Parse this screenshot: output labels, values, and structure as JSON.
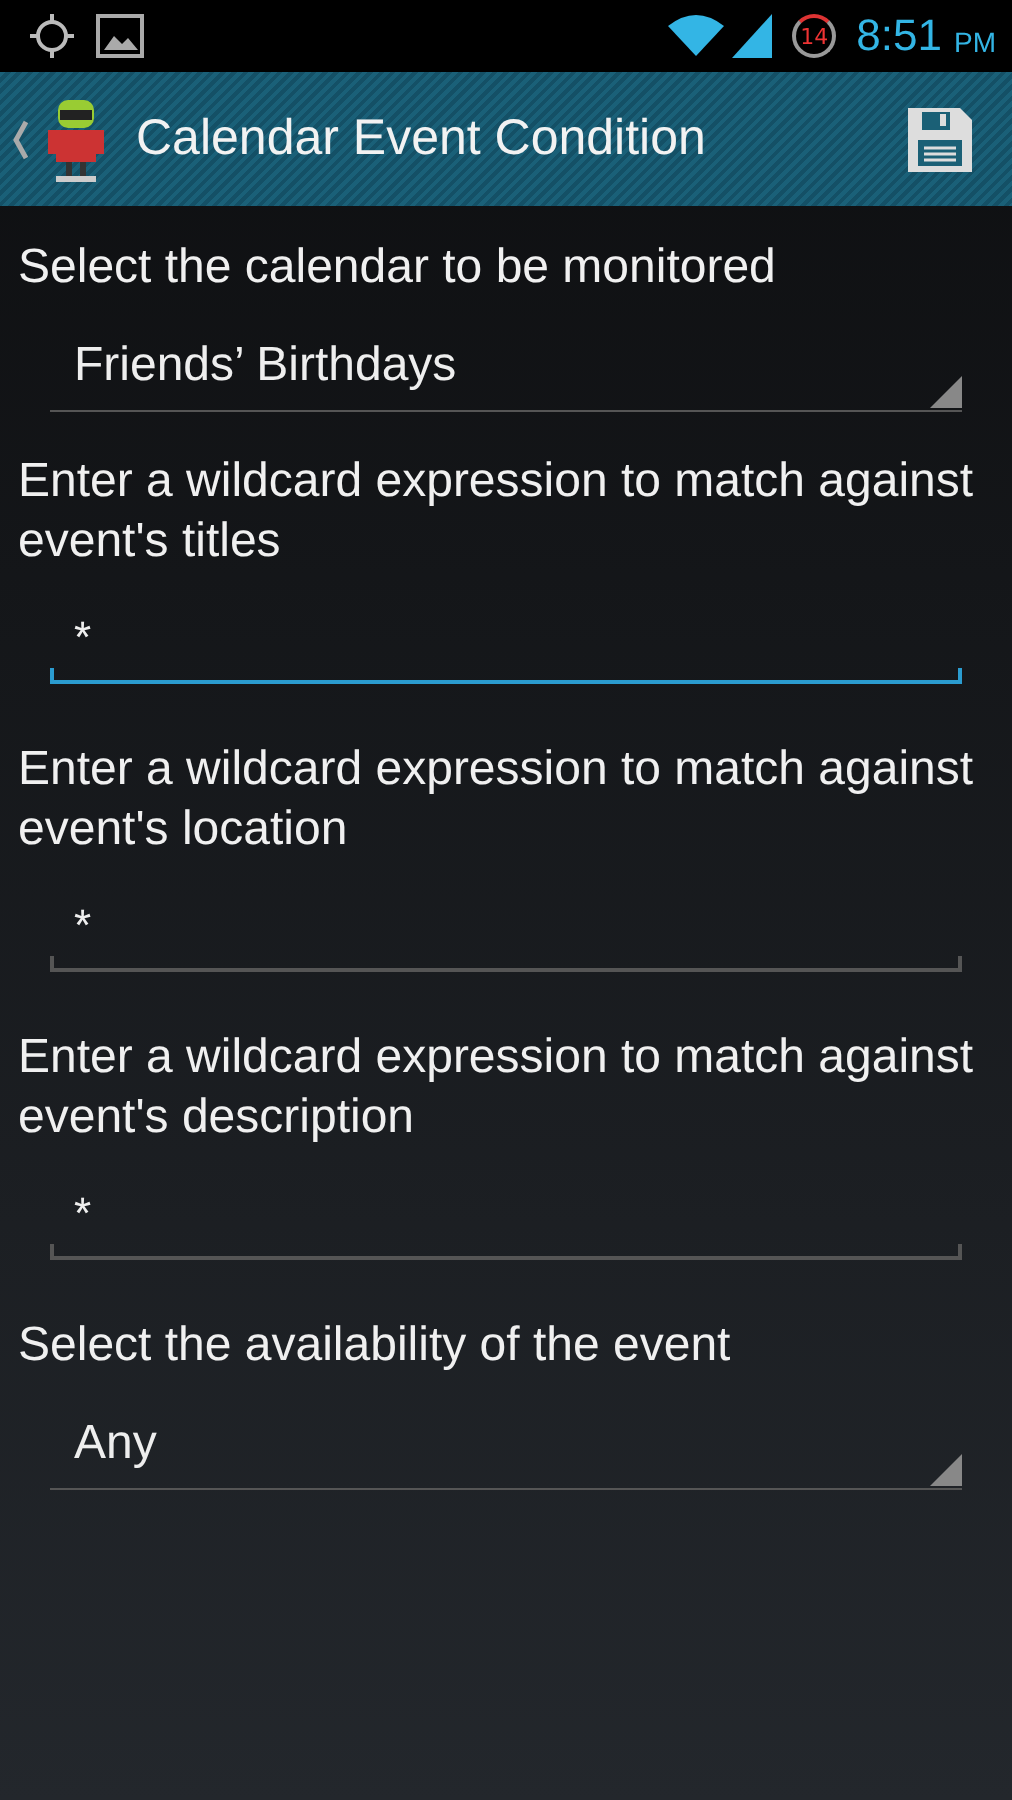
{
  "status_bar": {
    "notification_count": "14",
    "time": "8:51",
    "period": "PM"
  },
  "action_bar": {
    "title": "Calendar Event Condition"
  },
  "form": [
    {
      "label": "Select the calendar to be monitored",
      "kind": "spinner",
      "value": "Friends’ Birthdays"
    },
    {
      "label": "Enter a wildcard expression to match against event's titles",
      "kind": "text",
      "value": "*",
      "focused": true
    },
    {
      "label": "Enter a wildcard expression to match against event's location",
      "kind": "text",
      "value": "*",
      "focused": false
    },
    {
      "label": "Enter a wildcard expression to match against event's description",
      "kind": "text",
      "value": "*",
      "focused": false
    },
    {
      "label": "Select the availability of the event",
      "kind": "spinner",
      "value": "Any"
    }
  ]
}
